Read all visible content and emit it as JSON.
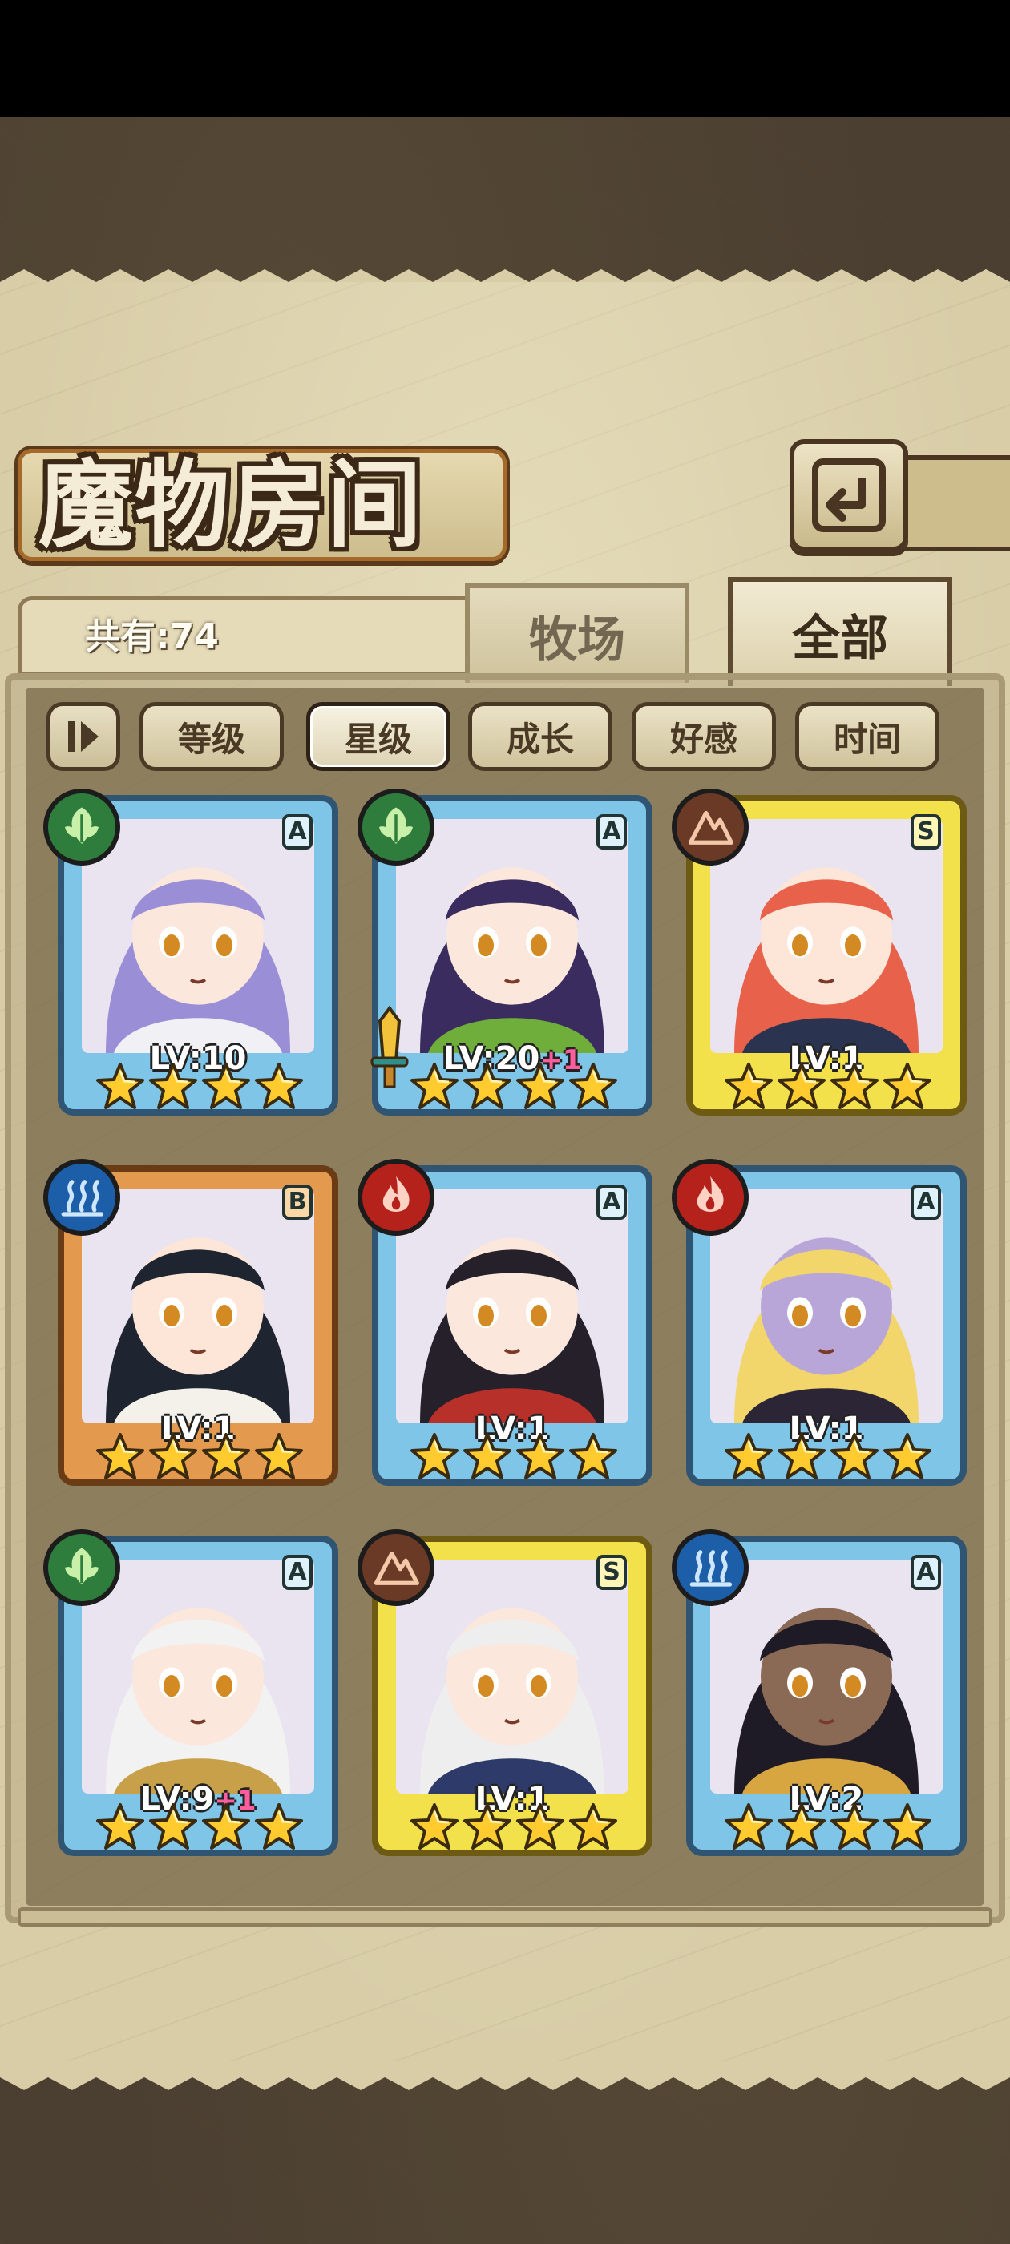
{
  "header": {
    "title": "魔物房间"
  },
  "count": {
    "label": "共有:74"
  },
  "tabs": [
    {
      "label": "牧场",
      "active": false
    },
    {
      "label": "全部",
      "active": true
    }
  ],
  "sort_buttons": [
    {
      "label": "等级",
      "active": false
    },
    {
      "label": "星级",
      "active": true
    },
    {
      "label": "成长",
      "active": false
    },
    {
      "label": "好感",
      "active": false
    },
    {
      "label": "时间",
      "active": false
    }
  ],
  "monsters": [
    {
      "element": "leaf",
      "rank": "A",
      "level": "LV:10",
      "bonus": "",
      "stars": 4,
      "hair": "#9a8fd6",
      "skin": "#fbe7dc",
      "outfit": "#f1f1f5"
    },
    {
      "element": "leaf",
      "rank": "A",
      "level": "LV:20",
      "bonus": "+1",
      "stars": 4,
      "hair": "#3a2c5e",
      "skin": "#fbe7dc",
      "outfit": "#6fae3a"
    },
    {
      "element": "earth",
      "rank": "S",
      "level": "LV:1",
      "bonus": "",
      "stars": 4,
      "hair": "#e8614a",
      "skin": "#fde6d8",
      "outfit": "#2a3350"
    },
    {
      "element": "water",
      "rank": "B",
      "level": "LV:1",
      "bonus": "",
      "stars": 4,
      "hair": "#1e2430",
      "skin": "#fde6d8",
      "outfit": "#f4f1ea"
    },
    {
      "element": "fire",
      "rank": "A",
      "level": "LV:1",
      "bonus": "",
      "stars": 4,
      "hair": "#25202a",
      "skin": "#fbe7dc",
      "outfit": "#b8302a"
    },
    {
      "element": "fire",
      "rank": "A",
      "level": "LV:1",
      "bonus": "",
      "stars": 4,
      "hair": "#f2d56b",
      "skin": "#b9a6d8",
      "outfit": "#2b2536"
    },
    {
      "element": "leaf",
      "rank": "A",
      "level": "LV:9",
      "bonus": "+1",
      "stars": 4,
      "hair": "#f2f2f2",
      "skin": "#fbe7dc",
      "outfit": "#c8a04a"
    },
    {
      "element": "earth",
      "rank": "S",
      "level": "LV:1",
      "bonus": "",
      "stars": 4,
      "hair": "#eeeeee",
      "skin": "#fbe7dc",
      "outfit": "#2e3a6a"
    },
    {
      "element": "water",
      "rank": "A",
      "level": "LV:2",
      "bonus": "",
      "stars": 4,
      "hair": "#1f1b26",
      "skin": "#8a6a54",
      "outfit": "#d8a640"
    }
  ]
}
